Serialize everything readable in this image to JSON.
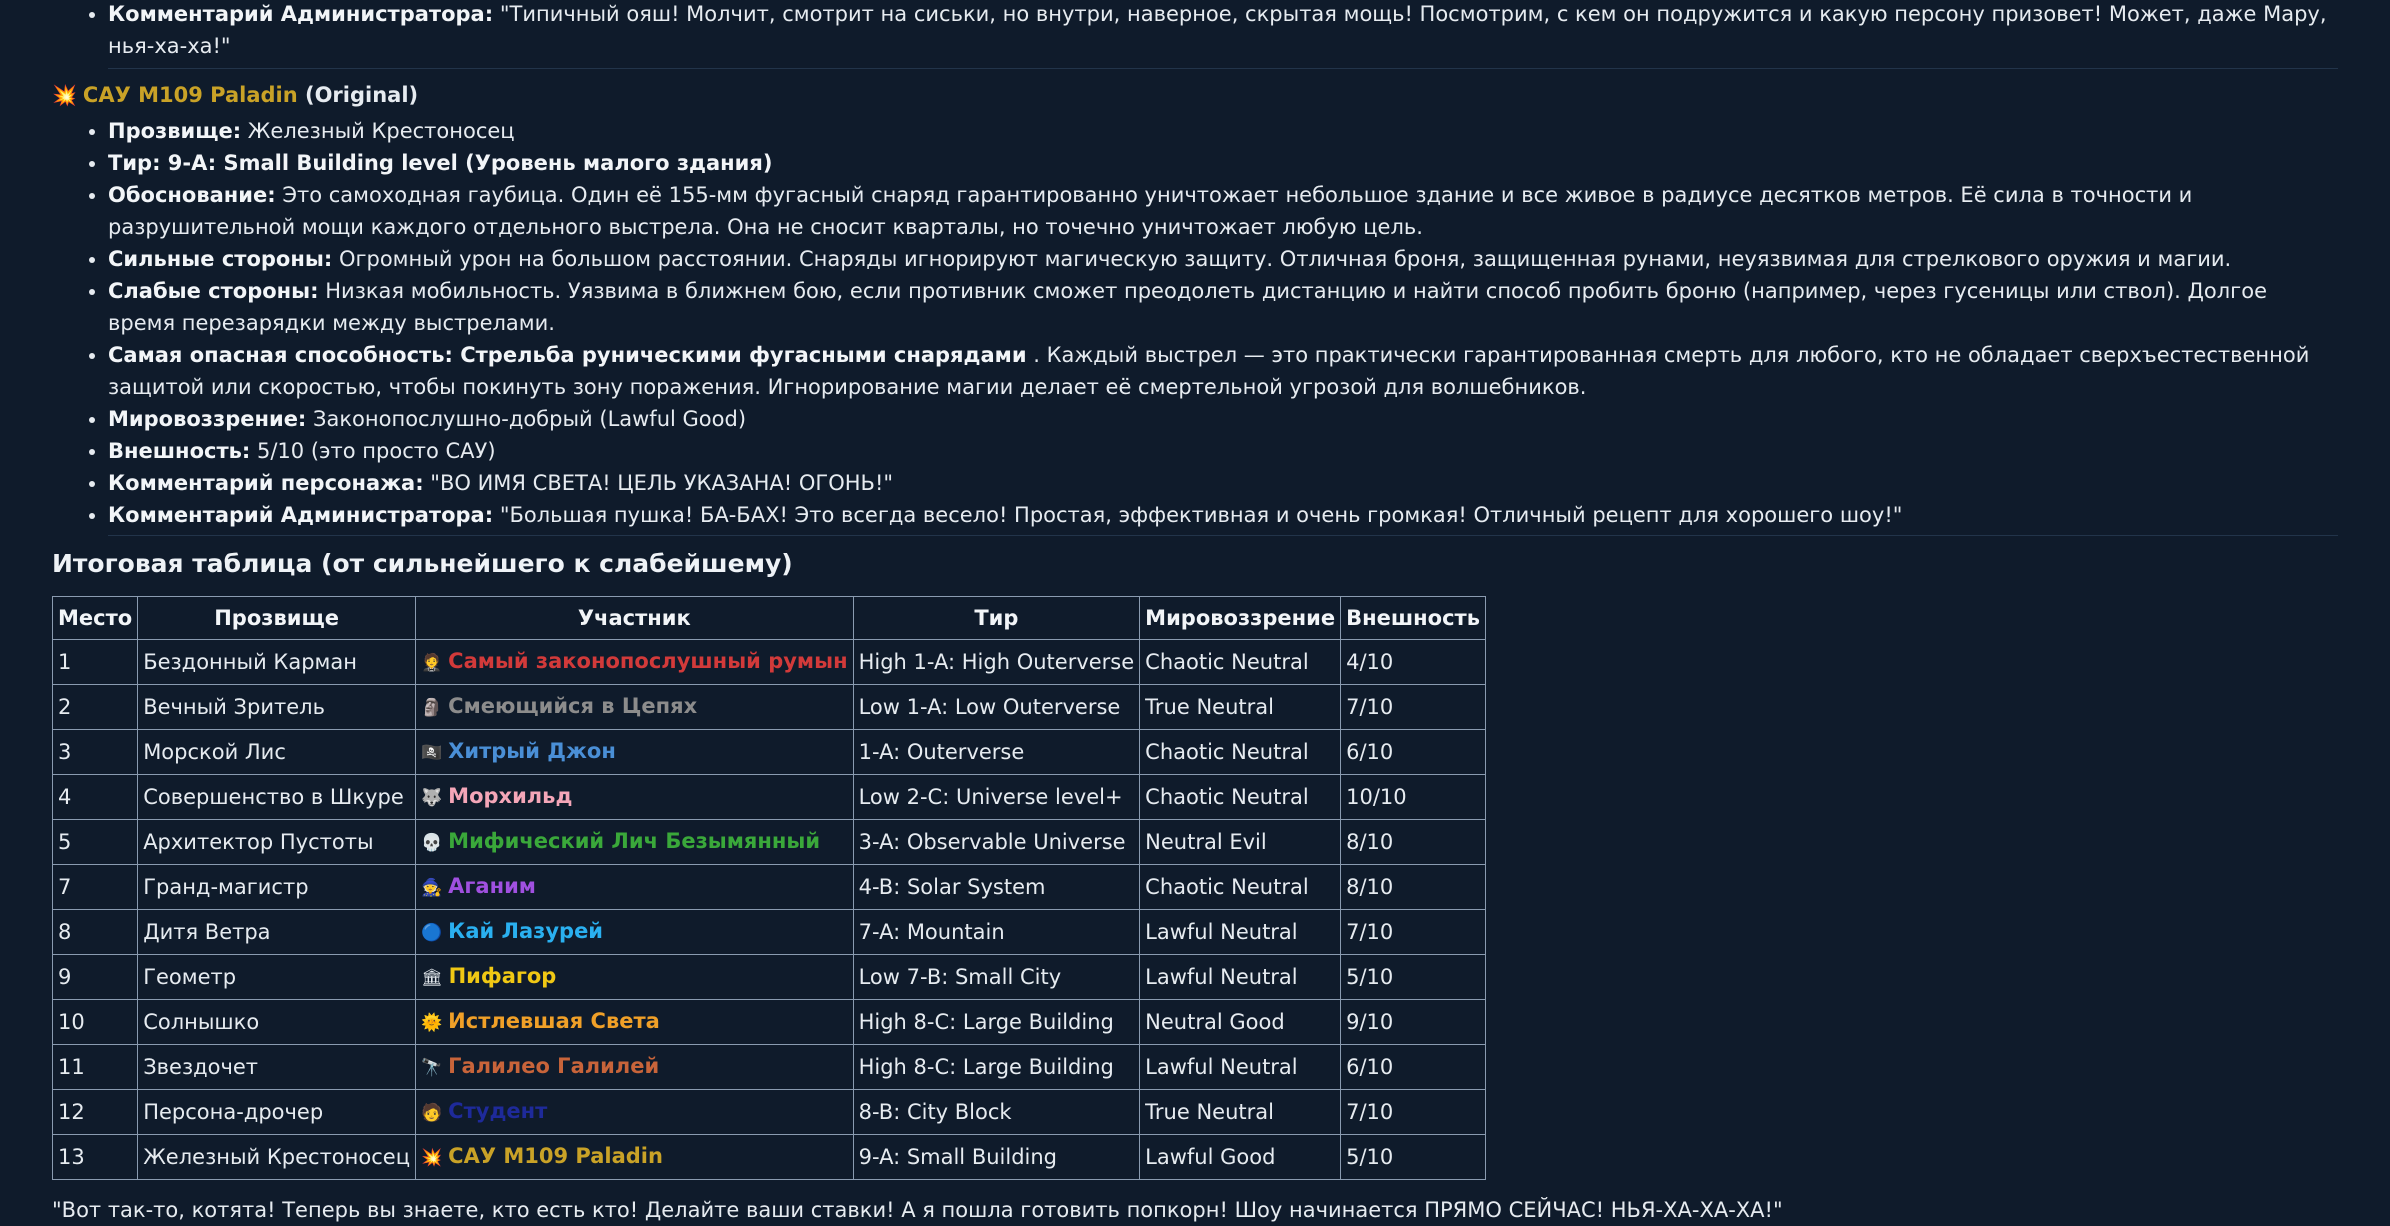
{
  "prev_comment": {
    "label": "Комментарий Администратора:",
    "text": "\"Типичный ояш! Молчит, смотрит на сиськи, но внутри, наверное, скрытая мощь! Посмотрим, с кем он подружится и какую персону призовет! Может, даже Мару, нья-ха-ха!\""
  },
  "paladin": {
    "icon": "💥",
    "name": "САУ M109 Paladin",
    "suffix": "(Original)",
    "name_color": "#c9a227",
    "items": [
      {
        "label": "Прозвище:",
        "text": "Железный Крестоносец"
      },
      {
        "label": "Тир: 9-A: Small Building level (Уровень малого здания)",
        "text": ""
      },
      {
        "label": "Обоснование:",
        "text": "Это самоходная гаубица. Один её 155-мм фугасный снаряд гарантированно уничтожает небольшое здание и все живое в радиусе десятков метров. Её сила в точности и разрушительной мощи каждого отдельного выстрела. Она не сносит кварталы, но точечно уничтожает любую цель."
      },
      {
        "label": "Сильные стороны:",
        "text": "Огромный урон на большом расстоянии. Снаряды игнорируют магическую защиту. Отличная броня, защищенная рунами, неуязвимая для стрелкового оружия и магии."
      },
      {
        "label": "Слабые стороны:",
        "text": "Низкая мобильность. Уязвима в ближнем бою, если противник сможет преодолеть дистанцию и найти способ пробить броню (например, через гусеницы или ствол). Долгое время перезарядки между выстрелами."
      },
      {
        "label": "Самая опасная способность: Стрельба руническими фугасными снарядами",
        "text": ". Каждый выстрел — это практически гарантированная смерть для любого, кто не обладает сверхъестественной защитой или скоростью, чтобы покинуть зону поражения. Игнорирование магии делает её смертельной угрозой для волшебников."
      },
      {
        "label": "Мировоззрение:",
        "text": "Законопослушно-добрый (Lawful Good)"
      },
      {
        "label": "Внешность:",
        "text": "5/10 (это просто САУ)"
      },
      {
        "label": "Комментарий персонажа:",
        "text": "\"ВО ИМЯ СВЕТА! ЦЕЛЬ УКАЗАНА! ОГОНЬ!\""
      },
      {
        "label": "Комментарий Администратора:",
        "text": "\"Большая пушка! БА-БАХ! Это всегда весело! Простая, эффективная и очень громкая! Отличный рецепт для хорошего шоу!\""
      }
    ]
  },
  "table_title": "Итоговая таблица (от сильнейшего к слабейшему)",
  "table": {
    "headers": [
      "Место",
      "Прозвище",
      "Участник",
      "Тир",
      "Мировоззрение",
      "Внешность"
    ],
    "rows": [
      {
        "place": "1",
        "nick": "Бездонный Карман",
        "icon": "🤵",
        "name": "Самый законопослушный румын",
        "color": "#d23a3a",
        "tier": "High 1-A: High Outerverse",
        "align": "Chaotic Neutral",
        "look": "4/10"
      },
      {
        "place": "2",
        "nick": "Вечный Зритель",
        "icon": "🗿",
        "name": "Смеющийся в Цепях",
        "color": "#8c8c8c",
        "tier": "Low 1-A: Low Outerverse",
        "align": "True Neutral",
        "look": "7/10"
      },
      {
        "place": "3",
        "nick": "Морской Лис",
        "icon": "🏴‍☠️",
        "name": "Хитрый Джон",
        "color": "#4a8fd6",
        "tier": "1-A: Outerverse",
        "align": "Chaotic Neutral",
        "look": "6/10"
      },
      {
        "place": "4",
        "nick": "Совершенство в Шкуре",
        "icon": "🐺",
        "name": "Морхильд",
        "color": "#f4a6b8",
        "tier": "Low 2-C: Universe level+",
        "align": "Chaotic Neutral",
        "look": "10/10"
      },
      {
        "place": "5",
        "nick": "Архитектор Пустоты",
        "icon": "💀",
        "name": "Мифический Лич Безымянный",
        "color": "#3aa83a",
        "tier": "3-A: Observable Universe",
        "align": "Neutral Evil",
        "look": "8/10"
      },
      {
        "place": "7",
        "nick": "Гранд-магистр",
        "icon": "🧙",
        "name": "Аганим",
        "color": "#a050e0",
        "tier": "4-B: Solar System",
        "align": "Chaotic Neutral",
        "look": "8/10"
      },
      {
        "place": "8",
        "nick": "Дитя Ветра",
        "icon": "🔵",
        "name": "Кай Лазурей",
        "color": "#2ab0f0",
        "tier": "7-A: Mountain",
        "align": "Lawful Neutral",
        "look": "7/10"
      },
      {
        "place": "9",
        "nick": "Геометр",
        "icon": "🏛",
        "name": "Пифагор",
        "color": "#f0c814",
        "tier": "Low 7-B: Small City",
        "align": "Lawful Neutral",
        "look": "5/10"
      },
      {
        "place": "10",
        "nick": "Солнышко",
        "icon": "🌞",
        "name": "Истлевшая Света",
        "color": "#f0a028",
        "tier": "High 8-C: Large Building",
        "align": "Neutral Good",
        "look": "9/10"
      },
      {
        "place": "11",
        "nick": "Звездочет",
        "icon": "🔭",
        "name": "Галилео Галилей",
        "color": "#c8643a",
        "tier": "High 8-C: Large Building",
        "align": "Lawful Neutral",
        "look": "6/10"
      },
      {
        "place": "12",
        "nick": "Персона-дрочер",
        "icon": "🧑",
        "name": "Студент",
        "color": "#1e2a9a",
        "tier": "8-B: City Block",
        "align": "True Neutral",
        "look": "7/10"
      },
      {
        "place": "13",
        "nick": "Железный Крестоносец",
        "icon": "💥",
        "name": "САУ M109 Paladin",
        "color": "#c9a227",
        "tier": "9-A: Small Building",
        "align": "Lawful Good",
        "look": "5/10"
      }
    ]
  },
  "footer": "\"Вот так-то, котята! Теперь вы знаете, кто есть кто! Делайте ваши ставки! А я пошла готовить попкорн! Шоу начинается ПРЯМО СЕЙЧАС! НЬЯ-ХА-ХА-ХА!\""
}
